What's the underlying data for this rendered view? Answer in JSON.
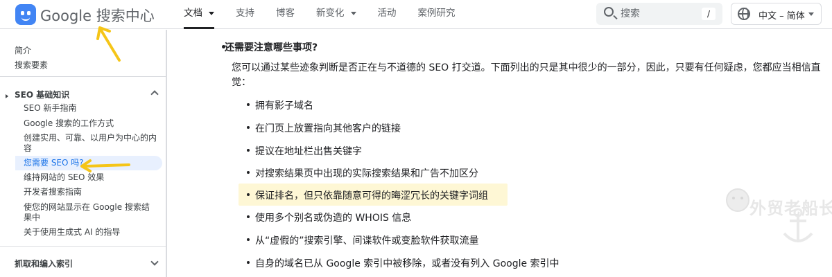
{
  "header": {
    "logo_text": "Google 搜索中心",
    "nav": [
      {
        "label": "文档",
        "active": true,
        "has_menu": true
      },
      {
        "label": "支持",
        "active": false,
        "has_menu": false
      },
      {
        "label": "博客",
        "active": false,
        "has_menu": false
      },
      {
        "label": "新变化",
        "active": false,
        "has_menu": true
      },
      {
        "label": "活动",
        "active": false,
        "has_menu": false
      },
      {
        "label": "案例研究",
        "active": false,
        "has_menu": false
      }
    ],
    "search": {
      "placeholder": "搜索",
      "shortcut": "/"
    },
    "language": "中文 – 简体"
  },
  "sidebar": {
    "top_links": [
      "简介",
      "搜索要素"
    ],
    "section_basics": {
      "title": "SEO 基础知识",
      "expanded": true,
      "items": [
        "SEO 新手指南",
        "Google 搜索的工作方式",
        "创建实用、可靠、以用户为中心的内容",
        "您需要 SEO 吗?",
        "维持网站的 SEO 效果",
        "开发者搜索指南",
        "使您的网站显示在 Google 搜索结果中",
        "关于使用生成式 AI 的指导"
      ],
      "active_item": "您需要 SEO 吗?"
    },
    "section_crawl": {
      "title": "抓取和编入索引",
      "expanded": false
    }
  },
  "main": {
    "heading": "还需要注意哪些事项?",
    "paragraph": "您可以通过某些迹象判断是否正在与不道德的 SEO 打交道。下面列出的只是其中很少的一部分，因此，只要有任何疑虑，您都应当相信直觉：",
    "list": [
      "拥有影子域名",
      "在门页上放置指向其他客户的链接",
      "提议在地址栏出售关键字",
      "对搜索结果页中出现的实际搜索结果和广告不加区分",
      "保证排名，但只依靠随意可得的晦涩冗长的关键字词组",
      "使用多个别名或伪造的 WHOIS 信息",
      "从“虚假的”搜索引擎、间谍软件或变脸软件获取流量",
      "自身的域名已从 Google 索引中被移除，或者没有列入 Google 索引中"
    ],
    "highlighted_index": 4
  },
  "overlay": {
    "watermark_text": "外贸老船长",
    "arrow_color": "#f5c518"
  }
}
